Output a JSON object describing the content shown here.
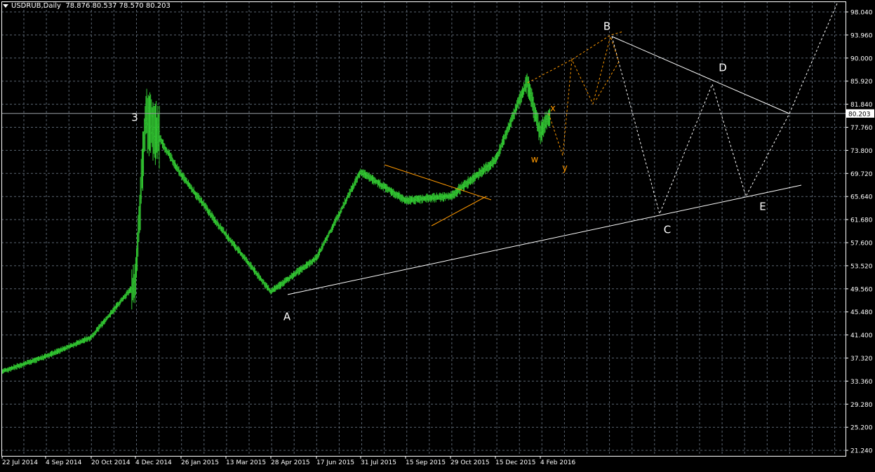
{
  "header": {
    "symbol": "USDRUB,Daily",
    "ohlc": "78.876 80.537 78.570 80.203"
  },
  "current_price_label": "80.203",
  "colors": {
    "background": "#000000",
    "grid": "#5a6470",
    "candles": "#33cc33",
    "axis_text": "#ffffff",
    "wave_white": "#ffffff",
    "wave_orange": "#ff9900",
    "price_line": "#9aa0a6"
  },
  "chart_data": {
    "type": "line",
    "title": "USDRUB,Daily",
    "xlabel": "",
    "ylabel": "",
    "ylim": [
      20.0,
      99.5
    ],
    "x_ticks": [
      "22 Jul 2014",
      "4 Sep 2014",
      "20 Oct 2014",
      "4 Dec 2014",
      "26 Jan 2015",
      "13 Mar 2015",
      "28 Apr 2015",
      "17 Jun 2015",
      "31 Jul 2015",
      "15 Sep 2015",
      "29 Oct 2015",
      "15 Dec 2015",
      "4 Feb 2016"
    ],
    "y_ticks": [
      "98.040",
      "93.960",
      "90.000",
      "85.920",
      "81.840",
      "77.760",
      "73.800",
      "69.720",
      "65.640",
      "61.680",
      "57.600",
      "53.520",
      "49.560",
      "45.480",
      "41.400",
      "37.320",
      "33.360",
      "29.280",
      "25.200",
      "21.240"
    ],
    "grid": true,
    "series": [
      {
        "name": "USDRUB",
        "x": [
          "22 Jul 2014",
          "4 Sep 2014",
          "20 Oct 2014",
          "4 Dec 2014",
          "16 Dec 2014",
          "26 Jan 2015",
          "13 Mar 2015",
          "28 Apr 2015",
          "17 Jun 2015",
          "31 Jul 2015",
          "15 Sep 2015",
          "29 Oct 2015",
          "15 Dec 2015",
          "20 Jan 2016",
          "4 Feb 2016",
          "15 Feb 2016"
        ],
        "values": [
          35.0,
          37.6,
          41.0,
          50.5,
          80.0,
          69.5,
          59.0,
          49.0,
          54.9,
          70.0,
          65.0,
          65.7,
          72.0,
          85.9,
          76.5,
          80.2
        ]
      }
    ],
    "annotations": [
      {
        "text": "3",
        "color": "#ffffff"
      },
      {
        "text": "A",
        "color": "#ffffff"
      },
      {
        "text": "B",
        "color": "#ffffff"
      },
      {
        "text": "C",
        "color": "#ffffff"
      },
      {
        "text": "D",
        "color": "#ffffff"
      },
      {
        "text": "E",
        "color": "#ffffff"
      },
      {
        "text": "w",
        "color": "#ff9900"
      },
      {
        "text": "x",
        "color": "#ff9900"
      },
      {
        "text": "y",
        "color": "#ff9900"
      }
    ]
  }
}
